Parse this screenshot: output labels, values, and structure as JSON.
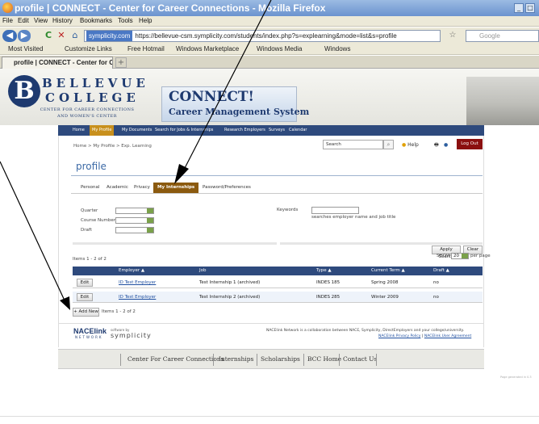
{
  "window": {
    "title": "profile | CONNECT - Center for Career Connections - Mozilla Firefox",
    "min": "_",
    "max": "□"
  },
  "menu": [
    "File",
    "Edit",
    "View",
    "History",
    "Bookmarks",
    "Tools",
    "Help"
  ],
  "nav": {
    "back": "◀",
    "forward": "▶",
    "reload": "C",
    "stop": "✕",
    "home": "⌂",
    "site_badge": "symplicity.com",
    "url": "https://bellevue-csm.symplicity.com/students/index.php?s=explearning&mode=list&s=profile",
    "star": "☆",
    "search_placeholder": "Google"
  },
  "bookmarks": [
    "Most Visited",
    "Customize Links",
    "Free Hotmail",
    "Windows Marketplace",
    "Windows Media",
    "Windows"
  ],
  "tab": {
    "label": "profile | CONNECT - Center for C...",
    "new": "+"
  },
  "header": {
    "college_letter": "B",
    "college_line1": "BELLEVUE",
    "college_line2": "COLLEGE",
    "sub_line1": "CENTER FOR CAREER CONNECTIONS",
    "sub_line2": "AND WOMEN'S CENTER",
    "connect_title": "CONNECT!",
    "connect_sub": "Career Management System"
  },
  "main_nav": [
    "Home",
    "My Profile",
    "My Documents",
    "Search for Jobs & Internships",
    "Research Employers",
    "Surveys",
    "Calendar"
  ],
  "breadcrumb": "Home > My Profile > Exp. Learning",
  "search": {
    "value": "Search",
    "icon": "magnifier-icon"
  },
  "tools": {
    "help": "Help",
    "logout": "Log Out"
  },
  "page_title": "profile",
  "subtabs": [
    "Personal",
    "Academic",
    "Privacy",
    "My Internships",
    "Password/Preferences"
  ],
  "filters": {
    "quarter": "Quarter",
    "course": "Course Number",
    "draft": "Draft",
    "keywords": "Keywords",
    "keywords_hint": "searches employer name and job title"
  },
  "buttons": {
    "apply": "Apply Search",
    "clear": "Clear",
    "add_new": "+ Add New",
    "edit": "Edit"
  },
  "paging": {
    "items": "Items 1 - 2 of 2",
    "show": "SHOW",
    "per_page_value": "20",
    "per_page": "per page"
  },
  "table": {
    "headers": [
      "Employer ▲",
      "Job",
      "Type ▲",
      "Current Term ▲",
      "Draft ▲"
    ],
    "rows": [
      {
        "employer": "ID Test Employer",
        "job": "Test Internship 1 (archived)",
        "type": "INDES 185",
        "term": "Spring 2008",
        "draft": "no"
      },
      {
        "employer": "ID Test Employer",
        "job": "Test Internship 2 (archived)",
        "type": "INDES 285",
        "term": "Winter 2009",
        "draft": "no"
      }
    ]
  },
  "footer": {
    "nace": "NACElink",
    "nace_sub": "NETWORK",
    "powered": "software by",
    "symplicity": "symplicity",
    "text": "NACElink Network is a collaboration between NACE, Symplicity, DirectEmployers and your college/university.",
    "privacy": "NACElink Privacy Policy",
    "divider": "|",
    "agreement": "NACElink User Agreement"
  },
  "bottom_nav": [
    "Center For Career Connections",
    "Internships",
    "Scholarships",
    "BCC Home",
    "Contact Us"
  ],
  "page_gen": "Page generated in 0.3"
}
